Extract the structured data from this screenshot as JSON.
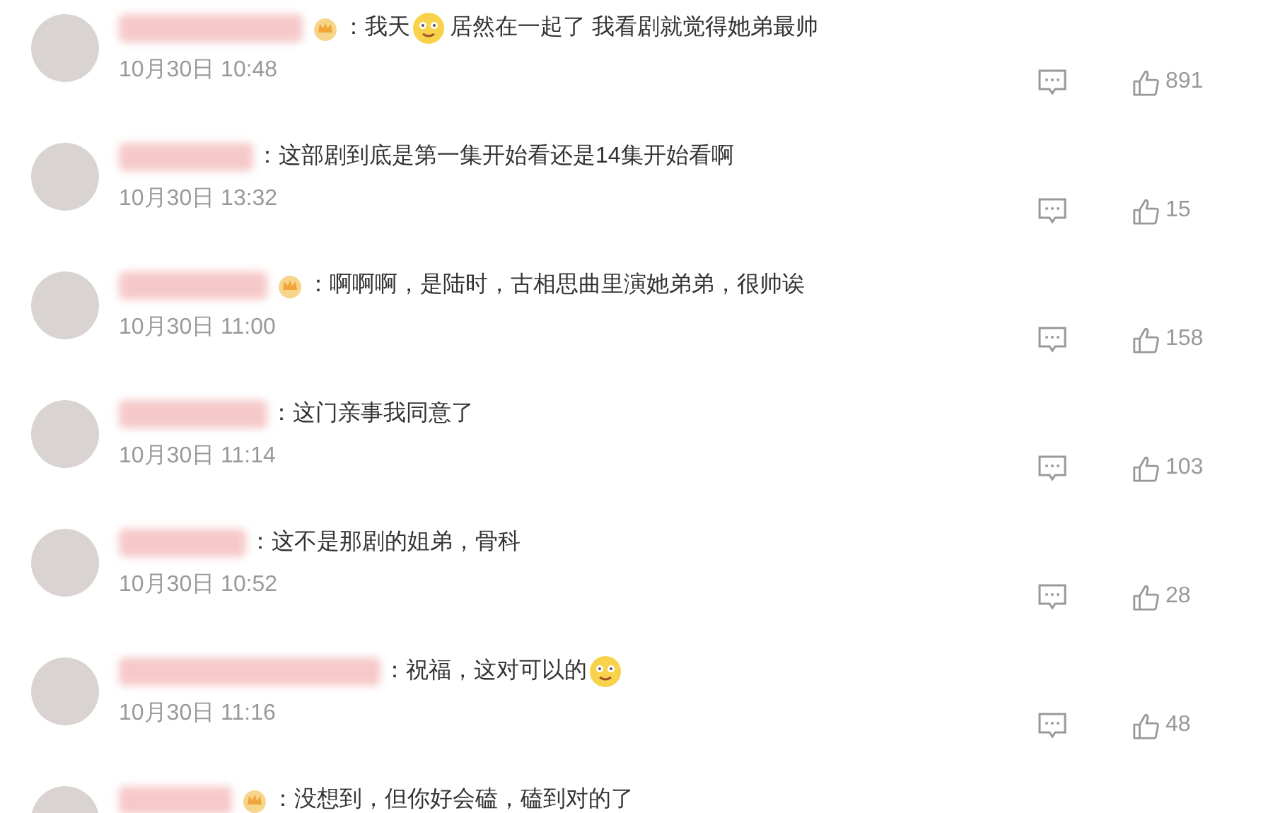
{
  "comments": [
    {
      "badge": true,
      "segments": [
        {
          "kind": "text",
          "text": "：我天"
        },
        {
          "kind": "emoji"
        },
        {
          "kind": "text",
          "text": "居然在一起了 我看剧就觉得她弟最帅"
        }
      ],
      "time": "10月30日 10:48",
      "likes": "891"
    },
    {
      "badge": false,
      "segments": [
        {
          "kind": "text",
          "text": "：这部剧到底是第一集开始看还是14集开始看啊"
        }
      ],
      "time": "10月30日 13:32",
      "likes": "15"
    },
    {
      "badge": true,
      "segments": [
        {
          "kind": "text",
          "text": "：啊啊啊，是陆时，古相思曲里演她弟弟，很帅诶"
        }
      ],
      "time": "10月30日 11:00",
      "likes": "158"
    },
    {
      "badge": false,
      "segments": [
        {
          "kind": "text",
          "text": "：这门亲事我同意了"
        }
      ],
      "time": "10月30日 11:14",
      "likes": "103"
    },
    {
      "badge": false,
      "segments": [
        {
          "kind": "text",
          "text": "：这不是那剧的姐弟，骨科"
        }
      ],
      "time": "10月30日 10:52",
      "likes": "28"
    },
    {
      "badge": false,
      "segments": [
        {
          "kind": "text",
          "text": "：祝福，这对可以的"
        },
        {
          "kind": "emoji"
        }
      ],
      "time": "10月30日 11:16",
      "likes": "48"
    },
    {
      "badge": true,
      "segments": [
        {
          "kind": "text",
          "text": "：没想到，但你好会磕，磕到对的了"
        }
      ]
    }
  ]
}
